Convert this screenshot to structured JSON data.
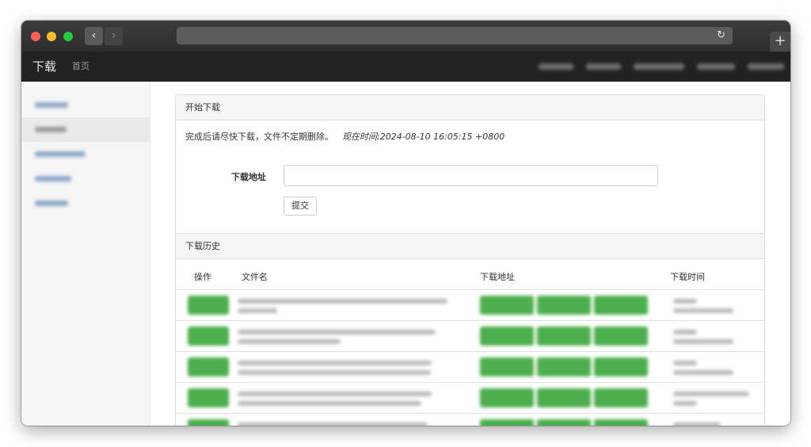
{
  "browser": {
    "back_icon": "chevron-left-icon",
    "forward_icon": "chevron-right-icon",
    "back_glyph": "‹",
    "forward_glyph": "›",
    "reload_glyph": "↻",
    "newtab_glyph": "+"
  },
  "navbar": {
    "brand": "下载",
    "home": "首页"
  },
  "form_panel": {
    "heading": "开始下载",
    "notice": "完成后请尽快下载，文件不定期删除。",
    "current_time": "现在时间:2024-08-10 16:05:15 +0800",
    "url_label": "下载地址",
    "url_value": "",
    "submit_label": "提交"
  },
  "history_panel": {
    "heading": "下载历史",
    "columns": {
      "action": "操作",
      "filename": "文件名",
      "url": "下载地址",
      "time": "下载时间"
    }
  },
  "colors": {
    "navbar_bg": "#222222",
    "action_green": "#4cae4c",
    "sidebar_bg": "#f5f5f5"
  }
}
